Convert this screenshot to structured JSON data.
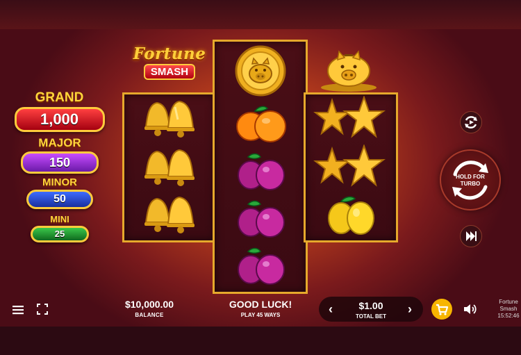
{
  "logo": {
    "line1": "Fortune",
    "line2": "SMASH"
  },
  "jackpots": {
    "grand": {
      "name": "GRAND",
      "value": "1,000"
    },
    "major": {
      "name": "MAJOR",
      "value": "150"
    },
    "minor": {
      "name": "MINOR",
      "value": "50"
    },
    "mini": {
      "name": "MINI",
      "value": "25"
    }
  },
  "reels": [
    {
      "symbols": [
        "bell",
        "bell",
        "bell"
      ]
    },
    {
      "symbols": [
        "pig-coin",
        "orange",
        "plum",
        "plum",
        "plum"
      ]
    },
    {
      "symbols": [
        "star",
        "star",
        "lemon"
      ]
    }
  ],
  "controls": {
    "spin_label_line1": "HOLD FOR",
    "spin_label_line2": "TURBO",
    "autoplay_icon": "autoplay-icon",
    "turbo_icon": "fast-forward-icon"
  },
  "bottom_bar": {
    "balance_value": "$10,000.00",
    "balance_label": "BALANCE",
    "message": "GOOD LUCK!",
    "message_sub": "PLAY 45 WAYS",
    "bet_value": "$1.00",
    "bet_label": "TOTAL BET",
    "bet_decrease": "‹",
    "bet_increase": "›",
    "game_name_line1": "Fortune",
    "game_name_line2": "Smash",
    "time": "15:52:46"
  },
  "colors": {
    "gold": "#ffcb3c",
    "grand": "#d01020",
    "major": "#9a2ad8",
    "minor": "#2a4ad0",
    "mini": "#1e9a30",
    "buy_button": "#f7b500"
  }
}
